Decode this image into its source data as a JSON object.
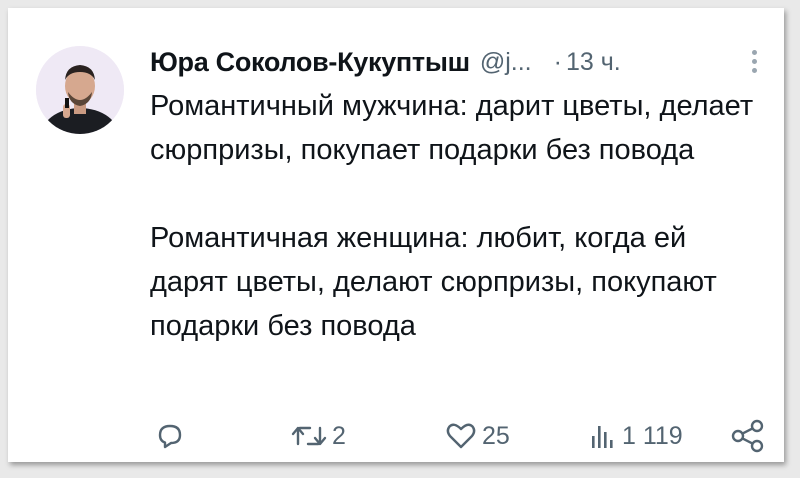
{
  "tweet": {
    "author_name": "Юра Соколов-Кукуптыш",
    "handle": "@j...",
    "separator": "·",
    "time": "13 ч.",
    "paragraph_1": "Романтичный мужчина: дарит цветы, делает сюрпризы, покупает подарки без повода",
    "paragraph_2": "Романтичная женщина: любит, когда ей дарят цветы, делают сюрпризы, покупают подарки без повода"
  },
  "actions": {
    "reply": {
      "icon": "reply-icon",
      "count": ""
    },
    "retweet": {
      "icon": "retweet-icon",
      "count": "2"
    },
    "like": {
      "icon": "heart-icon",
      "count": "25"
    },
    "views": {
      "icon": "views-icon",
      "count": "1 119"
    },
    "share": {
      "icon": "share-icon"
    }
  },
  "colors": {
    "text": "#0f1419",
    "secondary": "#536471",
    "background": "#ffffff"
  }
}
